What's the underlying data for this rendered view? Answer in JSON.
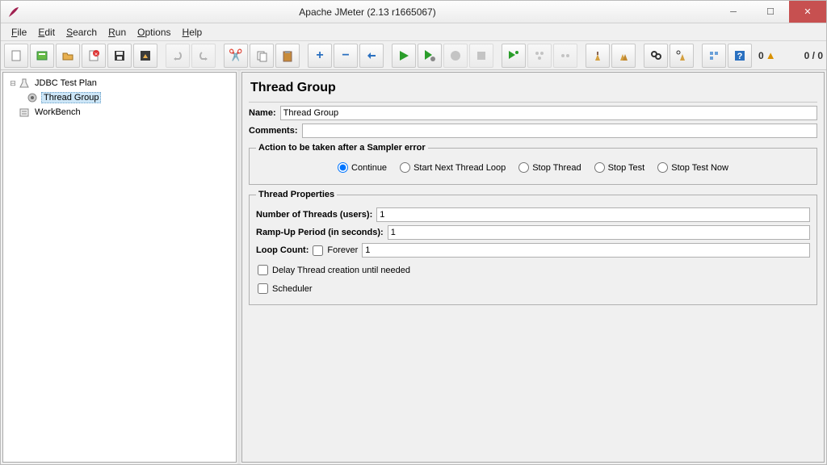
{
  "window": {
    "title": "Apache JMeter (2.13 r1665067)"
  },
  "menubar": {
    "items": [
      "File",
      "Edit",
      "Search",
      "Run",
      "Options",
      "Help"
    ]
  },
  "status": {
    "left_count": "0",
    "right_count": "0 / 0"
  },
  "tree": {
    "root": "JDBC Test Plan",
    "child": "Thread Group",
    "workbench": "WorkBench"
  },
  "panel": {
    "heading": "Thread Group",
    "name_label": "Name:",
    "name_value": "Thread Group",
    "comments_label": "Comments:",
    "comments_value": "",
    "error_group": "Action to be taken after a Sampler error",
    "error_options": [
      "Continue",
      "Start Next Thread Loop",
      "Stop Thread",
      "Stop Test",
      "Stop Test Now"
    ],
    "error_selected": 0,
    "thread_group_label": "Thread Properties",
    "num_threads_label": "Number of Threads (users):",
    "num_threads_value": "1",
    "rampup_label": "Ramp-Up Period (in seconds):",
    "rampup_value": "1",
    "loop_label": "Loop Count:",
    "forever_label": "Forever",
    "loop_value": "1",
    "delay_label": "Delay Thread creation until needed",
    "scheduler_label": "Scheduler"
  }
}
